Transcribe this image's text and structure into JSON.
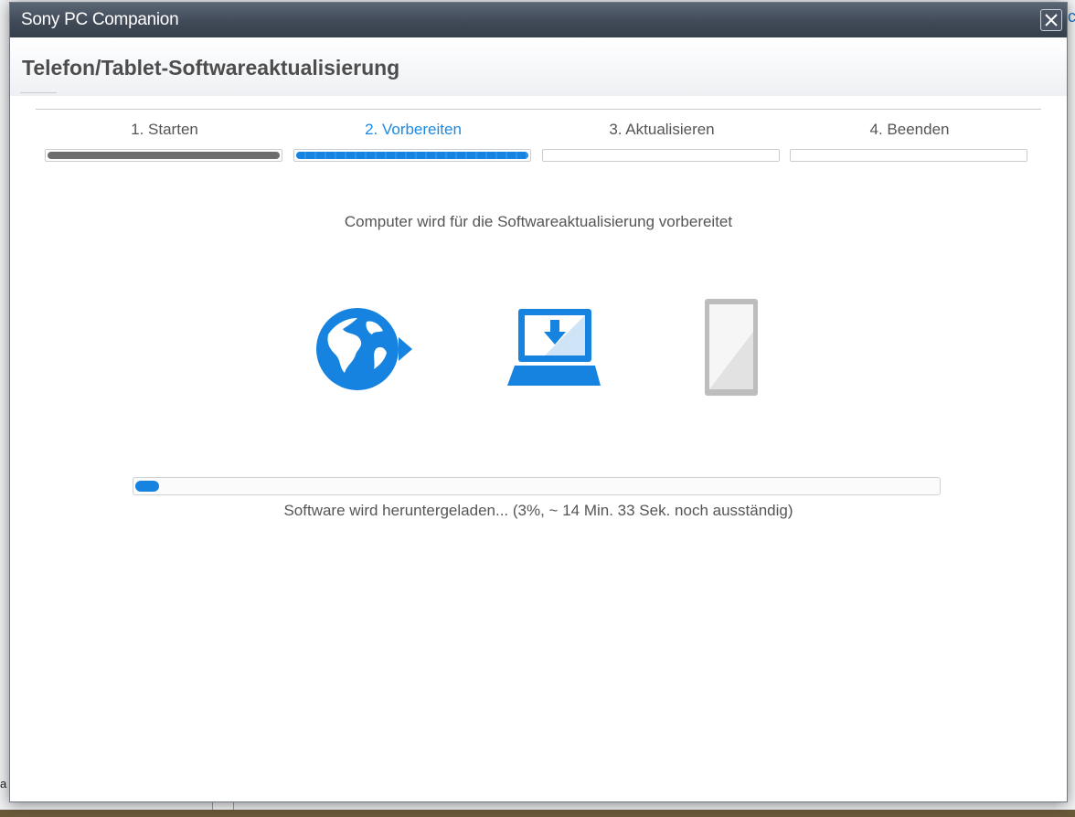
{
  "window": {
    "title": "Sony PC Companion"
  },
  "header": {
    "title": "Telefon/Tablet-Softwareaktualisierung"
  },
  "steps": [
    {
      "label": "1. Starten",
      "state": "done",
      "fill": 1.0
    },
    {
      "label": "2. Vorbereiten",
      "state": "active",
      "fill": 1.0
    },
    {
      "label": "3. Aktualisieren",
      "state": "pending",
      "fill": 0
    },
    {
      "label": "4. Beenden",
      "state": "pending",
      "fill": 0
    }
  ],
  "main": {
    "status": "Computer wird für die Softwareaktualisierung vorbereitet",
    "icons": [
      "globe-icon",
      "laptop-download-icon",
      "phone-icon"
    ],
    "progress": {
      "percent": 3,
      "text": "Software wird heruntergeladen... (3%,  ~ 14 Min. 33 Sek. noch ausständig)"
    }
  },
  "background": {
    "right_link": "lc",
    "bottom_left_text": "a"
  },
  "colors": {
    "accent": "#1683e0",
    "done": "#6e6e6e",
    "titlebar": "#404a57"
  }
}
